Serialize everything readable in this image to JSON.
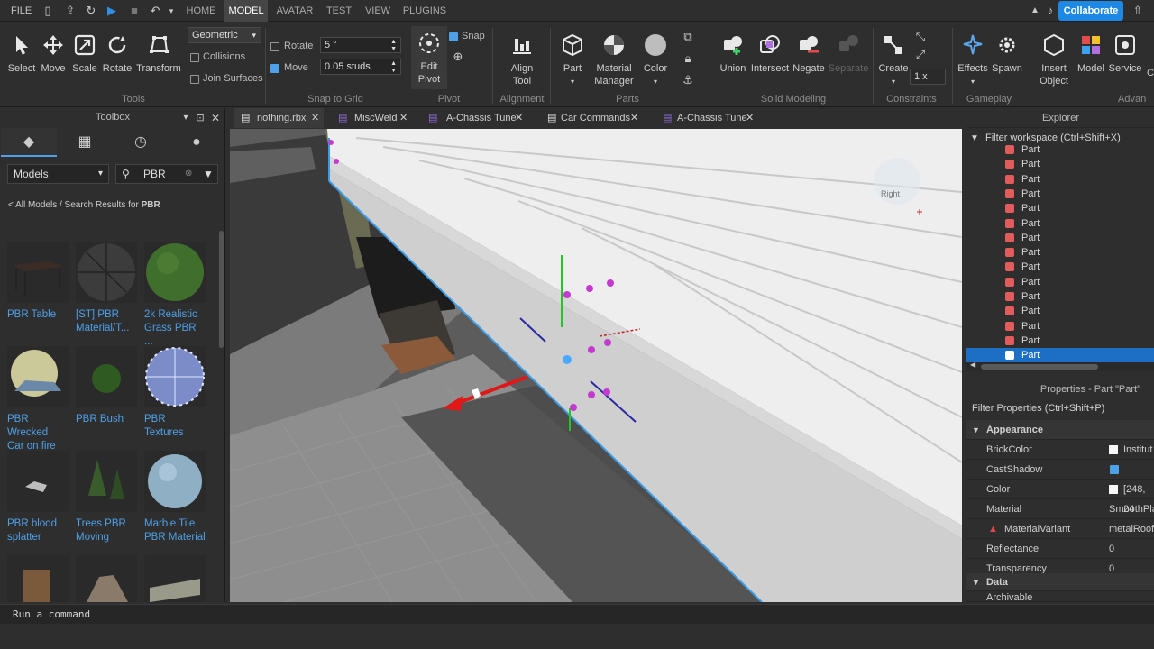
{
  "menubar": {
    "file": "FILE",
    "tabs": [
      "HOME",
      "MODEL",
      "AVATAR",
      "TEST",
      "VIEW",
      "PLUGINS"
    ],
    "active_tab": "MODEL",
    "collaborate": "Collaborate"
  },
  "ribbon": {
    "tools": {
      "select": "Select",
      "move": "Move",
      "scale": "Scale",
      "rotate": "Rotate",
      "transform": "Transform",
      "mode": "Geometric",
      "collisions": "Collisions",
      "join_surfaces": "Join Surfaces",
      "group": "Tools"
    },
    "snap": {
      "rotate_label": "Rotate",
      "rotate_value": "5 °",
      "move_label": "Move",
      "move_value": "0.05 studs",
      "group": "Snap to Grid"
    },
    "pivot": {
      "edit": "Edit",
      "pivot": "Pivot",
      "snap": "Snap",
      "group": "Pivot"
    },
    "alignment": {
      "align": "Align",
      "tool": "Tool",
      "group": "Alignment"
    },
    "parts": {
      "part": "Part",
      "material": "Material",
      "manager": "Manager",
      "color": "Color",
      "group": "Parts"
    },
    "solid": {
      "union": "Union",
      "intersect": "Intersect",
      "negate": "Negate",
      "separate": "Separate",
      "group": "Solid Modeling"
    },
    "constraints": {
      "create": "Create",
      "scale": "1 x",
      "group": "Constraints"
    },
    "gameplay": {
      "effects": "Effects",
      "spawn": "Spawn",
      "group": "Gameplay"
    },
    "advanced": {
      "insert": "Insert",
      "object": "Object",
      "model": "Model",
      "service": "Service",
      "c": "C",
      "group": "Advan"
    }
  },
  "toolbox": {
    "title": "Toolbox",
    "dropdown": "Models",
    "search": "PBR",
    "breadcrumb_prefix": "< All Models / Search Results for ",
    "breadcrumb_term": "PBR",
    "items": [
      {
        "name1": "PBR Table",
        "name2": ""
      },
      {
        "name1": "[ST] PBR",
        "name2": "Material/T..."
      },
      {
        "name1": "2k Realistic",
        "name2": "Grass PBR ..."
      },
      {
        "name1": "PBR Wrecked",
        "name2": "Car on fire"
      },
      {
        "name1": "PBR Bush",
        "name2": ""
      },
      {
        "name1": "PBR Textures",
        "name2": ""
      },
      {
        "name1": "PBR blood",
        "name2": "splatter"
      },
      {
        "name1": "Trees PBR",
        "name2": "Moving"
      },
      {
        "name1": "Marble Tile",
        "name2": "PBR Material"
      },
      {
        "name1": "",
        "name2": ""
      },
      {
        "name1": "",
        "name2": ""
      },
      {
        "name1": "",
        "name2": ""
      }
    ]
  },
  "doc_tabs": [
    "nothing.rbx",
    "MiscWeld",
    "A-Chassis Tune",
    "Car Commands",
    "A-Chassis Tune"
  ],
  "viewport": {
    "cube_label": "Right"
  },
  "explorer": {
    "title": "Explorer",
    "filter": "Filter workspace (Ctrl+Shift+X)",
    "parts": [
      "Part",
      "Part",
      "Part",
      "Part",
      "Part",
      "Part",
      "Part",
      "Part",
      "Part",
      "Part",
      "Part",
      "Part",
      "Part",
      "Part",
      "Part"
    ]
  },
  "properties": {
    "title": "Properties - Part \"Part\"",
    "filter": "Filter Properties (Ctrl+Shift+P)",
    "appearance": "Appearance",
    "rows": [
      {
        "name": "BrickColor",
        "value": "Institut"
      },
      {
        "name": "CastShadow",
        "value": ""
      },
      {
        "name": "Color",
        "value": "[248, 24"
      },
      {
        "name": "Material",
        "value": "SmoothPla"
      },
      {
        "name": "MaterialVariant",
        "value": "metalRoof"
      },
      {
        "name": "Reflectance",
        "value": "0"
      },
      {
        "name": "Transparency",
        "value": "0"
      }
    ],
    "data": "Data",
    "archivable": "Archivable"
  },
  "command": {
    "placeholder": "Run a command"
  },
  "colors": {
    "accent": "#1e88e5",
    "selection": "#1d6fc6",
    "link": "#4ea0e8"
  }
}
